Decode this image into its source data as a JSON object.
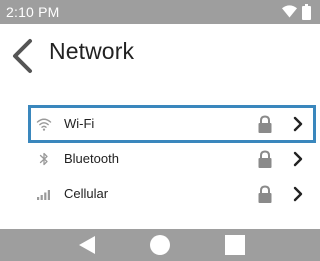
{
  "status_bar": {
    "time": "2:10 PM"
  },
  "header": {
    "title": "Network"
  },
  "network_items": [
    {
      "label": "Wi-Fi",
      "icon": "wifi-icon",
      "locked": true,
      "selected": true
    },
    {
      "label": "Bluetooth",
      "icon": "bluetooth-icon",
      "locked": true,
      "selected": false
    },
    {
      "label": "Cellular",
      "icon": "cellular-signal-icon",
      "locked": true,
      "selected": false
    }
  ],
  "colors": {
    "bar": "#9e9e9e",
    "selection_outline": "#3a87bd",
    "text": "#222222",
    "icon_muted": "#9a9a9a",
    "lock": "#8a8a8a"
  }
}
